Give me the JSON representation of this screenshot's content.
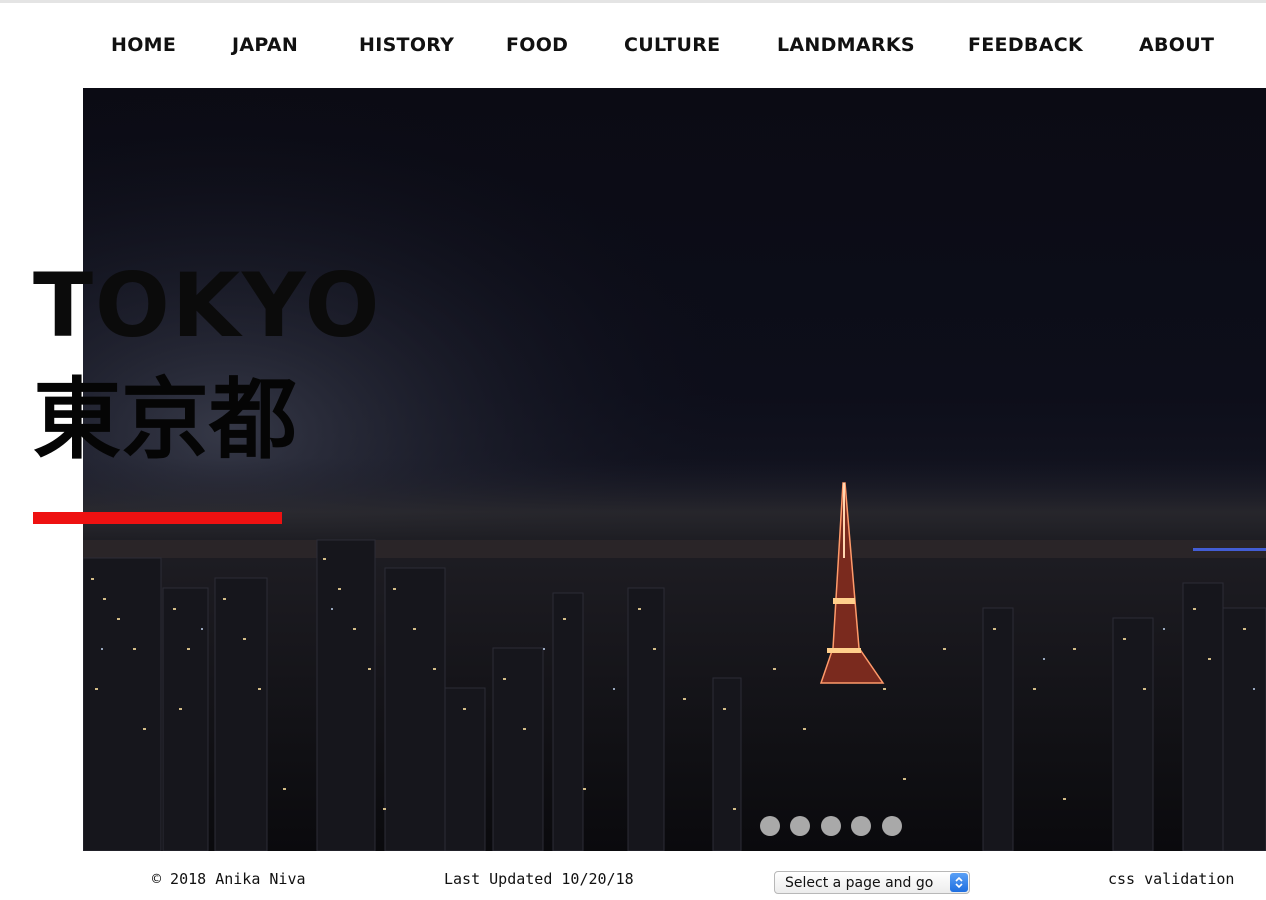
{
  "nav": {
    "items": [
      {
        "label": "HOME"
      },
      {
        "label": "JAPAN"
      },
      {
        "label": "HISTORY"
      },
      {
        "label": "FOOD"
      },
      {
        "label": "CULTURE"
      },
      {
        "label": "LANDMARKS"
      },
      {
        "label": "FEEDBACK"
      },
      {
        "label": "ABOUT"
      }
    ]
  },
  "hero": {
    "title_en": "TOKYO",
    "title_jp": "東京都",
    "image_subject": "tokyo-night-skyline-photo",
    "slide_count": 5,
    "accent_color": "#ee1111"
  },
  "footer": {
    "copyright": "© 2018 Anika Niva",
    "last_updated": "Last Updated 10/20/18",
    "page_select": {
      "selected": "Select a page and go"
    },
    "validation_link": "css validation"
  }
}
